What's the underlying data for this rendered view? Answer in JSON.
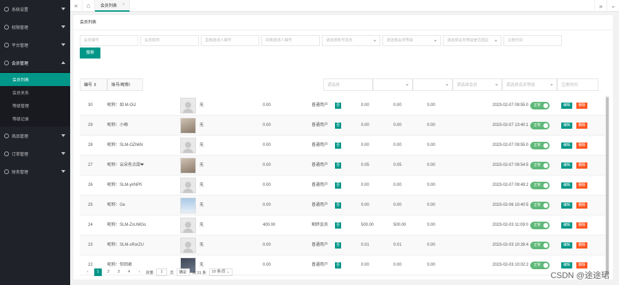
{
  "sidebar": {
    "menus": [
      {
        "label": "系统设置",
        "open": false
      },
      {
        "label": "权限管理",
        "open": false
      },
      {
        "label": "平台管理",
        "open": false
      },
      {
        "label": "会员管理",
        "open": true
      },
      {
        "label": "商品管理",
        "open": false
      },
      {
        "label": "订单管理",
        "open": false
      },
      {
        "label": "财务管理",
        "open": false
      }
    ],
    "submenu": [
      "会员列表",
      "会员关系",
      "等级管理",
      "等级记录"
    ],
    "active_sub": 0
  },
  "topbar": {
    "tab_label": "会员列表",
    "close_glyph": "×",
    "left_glyph": "«",
    "home_glyph": "⌂",
    "right_glyph": "»",
    "menu_glyph": "⌄"
  },
  "card": {
    "title": "会员列表",
    "filters_row1": [
      "会员编号",
      "会员昵称",
      "直推邀请人编号",
      "间推邀请人编号",
      "请选择账号状态",
      "请选择会员等级",
      "请选择会员等级是否固定",
      "注册时间"
    ],
    "search_label": "搜索",
    "header": [
      "编号 ⇕",
      "账号/昵称/",
      "",
      "",
      "",
      "请选择",
      "",
      "",
      "请选择会员",
      "请选择会员等级",
      "注册时间"
    ]
  },
  "rows": [
    {
      "id": "30",
      "nick": "昵称：如 M-OiJ",
      "avatar": "default",
      "invite": "无",
      "balance": "0.00",
      "level": "普通用户",
      "flag": "否",
      "a": "0.00",
      "b": "0.00",
      "c": "0.00",
      "status": "正常",
      "time": "2023-02-07 09:55:0"
    },
    {
      "id": "29",
      "nick": "昵称：小梅",
      "avatar": "photo",
      "invite": "无",
      "balance": "0.00",
      "level": "普通用户",
      "flag": "否",
      "a": "0.00",
      "b": "0.00",
      "c": "0.00",
      "status": "正常",
      "time": "2023-02-07 13:40:1"
    },
    {
      "id": "28",
      "nick": "昵称：SLM-OZh6N",
      "avatar": "default",
      "invite": "无",
      "balance": "0.00",
      "level": "普通用户",
      "flag": "否",
      "a": "0.00",
      "b": "0.00",
      "c": "0.00",
      "status": "正常",
      "time": "2023-02-07 09:55:0"
    },
    {
      "id": "27",
      "nick": "昵称：云朵有点甜❤",
      "avatar": "photo",
      "invite": "无",
      "balance": "0.00",
      "level": "普通用户",
      "flag": "否",
      "a": "0.05",
      "b": "0.05",
      "c": "0.00",
      "status": "正常",
      "time": "2023-02-07 09:54:5"
    },
    {
      "id": "26",
      "nick": "昵称：SLM-ylrNPfi",
      "avatar": "default",
      "invite": "无",
      "balance": "0.00",
      "level": "普通用户",
      "flag": "否",
      "a": "0.00",
      "b": "0.00",
      "c": "0.00",
      "status": "正常",
      "time": "2023-02-07 09:49:2"
    },
    {
      "id": "25",
      "nick": "昵称：Ge",
      "avatar": "sky",
      "invite": "无",
      "balance": "0.00",
      "level": "普通用户",
      "flag": "否",
      "a": "0.00",
      "b": "0.00",
      "c": "0.00",
      "status": "正常",
      "time": "2023-02-06 10:40:5"
    },
    {
      "id": "24",
      "nick": "昵称：SLM-ZsUMGo",
      "avatar": "default",
      "invite": "无",
      "balance": "400.00",
      "level": "割终会员",
      "flag": "否",
      "a": "500.00",
      "b": "500.00",
      "c": "0.00",
      "status": "正常",
      "time": "2023-02-03 11:09:0"
    },
    {
      "id": "23",
      "nick": "昵称：SLM-sRorZU",
      "avatar": "default",
      "invite": "无",
      "balance": "0.00",
      "level": "普通用户",
      "flag": "否",
      "a": "0.01",
      "b": "0.01",
      "c": "0.00",
      "status": "正常",
      "time": "2023-02-03 10:26:4"
    },
    {
      "id": "22",
      "nick": "昵称：你回君",
      "avatar": "dark",
      "invite": "无",
      "balance": "0.00",
      "level": "普通用户",
      "flag": "否",
      "a": "0.00",
      "b": "0.00",
      "c": "0.00",
      "status": "正常",
      "time": "2023-02-03 10:02:2"
    }
  ],
  "row_actions": {
    "edit": "编辑",
    "delete": "删除"
  },
  "pagination": {
    "prev": "‹",
    "pages": [
      "1",
      "2",
      "3",
      "4"
    ],
    "next": "›",
    "goto_label": "到第",
    "goto_value": "1",
    "page_unit": "页",
    "confirm": "确定",
    "total": "共 31 条",
    "page_size": "10 条/页 ⌄"
  },
  "watermark": "CSDN @途途珺",
  "colors": {
    "accent": "#009688",
    "sidebar": "#20222a",
    "danger": "#ff5722",
    "switch": "#5fb878"
  }
}
